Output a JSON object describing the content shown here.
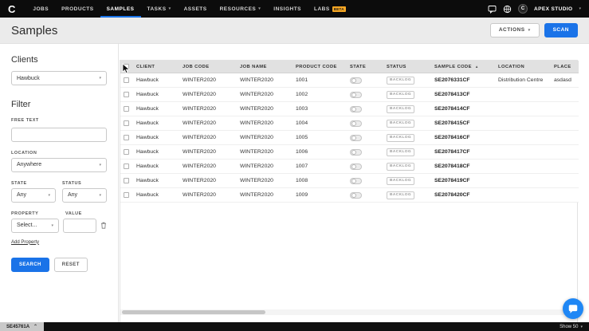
{
  "colors": {
    "accent": "#1a73e8",
    "nav_bg": "#0c0c0c",
    "beta_badge": "#f5a623",
    "chat_bubble": "#1f87f5"
  },
  "nav": {
    "logo_letter": "C",
    "items": [
      {
        "label": "JOBS",
        "active": false,
        "dropdown": false
      },
      {
        "label": "PRODUCTS",
        "active": false,
        "dropdown": false
      },
      {
        "label": "SAMPLES",
        "active": true,
        "dropdown": false
      },
      {
        "label": "TASKS",
        "active": false,
        "dropdown": true
      },
      {
        "label": "ASSETS",
        "active": false,
        "dropdown": false
      },
      {
        "label": "RESOURCES",
        "active": false,
        "dropdown": true
      },
      {
        "label": "INSIGHTS",
        "active": false,
        "dropdown": false
      },
      {
        "label": "LABS",
        "active": false,
        "dropdown": false,
        "badge": "BETA"
      }
    ],
    "account_name": "APEX STUDIO",
    "avatar_letter": "C"
  },
  "header": {
    "title": "Samples",
    "actions_button": "ACTIONS",
    "scan_button": "SCAN"
  },
  "sidebar": {
    "clients_heading": "Clients",
    "client_selected": "Hawbuck",
    "filter_heading": "Filter",
    "free_text_label": "FREE TEXT",
    "free_text_value": "",
    "location_label": "LOCATION",
    "location_selected": "Anywhere",
    "state_label": "STATE",
    "state_selected": "Any",
    "status_label": "STATUS",
    "status_selected": "Any",
    "property_label": "PROPERTY",
    "property_selected": "Select...",
    "value_label": "VALUE",
    "value_value": "",
    "add_property_link": "Add Property",
    "search_button": "SEARCH",
    "reset_button": "RESET"
  },
  "table": {
    "columns": [
      "CLIENT",
      "JOB CODE",
      "JOB NAME",
      "PRODUCT CODE",
      "STATE",
      "STATUS",
      "SAMPLE CODE",
      "LOCATION",
      "PLACE"
    ],
    "sorted_column": "SAMPLE CODE",
    "sort_direction": "asc",
    "rows": [
      {
        "client": "Hawbuck",
        "job_code": "WINTER2020",
        "job_name": "WINTER2020",
        "product_code": "1001",
        "state_on": false,
        "status": "BACKLOG",
        "sample_code": "SE2076331CF",
        "location": "Distribution Centre",
        "place": "asdasd"
      },
      {
        "client": "Hawbuck",
        "job_code": "WINTER2020",
        "job_name": "WINTER2020",
        "product_code": "1002",
        "state_on": false,
        "status": "BACKLOG",
        "sample_code": "SE2078413CF",
        "location": "",
        "place": ""
      },
      {
        "client": "Hawbuck",
        "job_code": "WINTER2020",
        "job_name": "WINTER2020",
        "product_code": "1003",
        "state_on": false,
        "status": "BACKLOG",
        "sample_code": "SE2078414CF",
        "location": "",
        "place": ""
      },
      {
        "client": "Hawbuck",
        "job_code": "WINTER2020",
        "job_name": "WINTER2020",
        "product_code": "1004",
        "state_on": false,
        "status": "BACKLOG",
        "sample_code": "SE2078415CF",
        "location": "",
        "place": ""
      },
      {
        "client": "Hawbuck",
        "job_code": "WINTER2020",
        "job_name": "WINTER2020",
        "product_code": "1005",
        "state_on": false,
        "status": "BACKLOG",
        "sample_code": "SE2078416CF",
        "location": "",
        "place": ""
      },
      {
        "client": "Hawbuck",
        "job_code": "WINTER2020",
        "job_name": "WINTER2020",
        "product_code": "1006",
        "state_on": false,
        "status": "BACKLOG",
        "sample_code": "SE2078417CF",
        "location": "",
        "place": ""
      },
      {
        "client": "Hawbuck",
        "job_code": "WINTER2020",
        "job_name": "WINTER2020",
        "product_code": "1007",
        "state_on": false,
        "status": "BACKLOG",
        "sample_code": "SE2078418CF",
        "location": "",
        "place": ""
      },
      {
        "client": "Hawbuck",
        "job_code": "WINTER2020",
        "job_name": "WINTER2020",
        "product_code": "1008",
        "state_on": false,
        "status": "BACKLOG",
        "sample_code": "SE2078419CF",
        "location": "",
        "place": ""
      },
      {
        "client": "Hawbuck",
        "job_code": "WINTER2020",
        "job_name": "WINTER2020",
        "product_code": "1009",
        "state_on": false,
        "status": "BACKLOG",
        "sample_code": "SE2078420CF",
        "location": "",
        "place": ""
      }
    ]
  },
  "footer": {
    "tray_label": "SE45761A",
    "page_size_label": "Show 50"
  }
}
